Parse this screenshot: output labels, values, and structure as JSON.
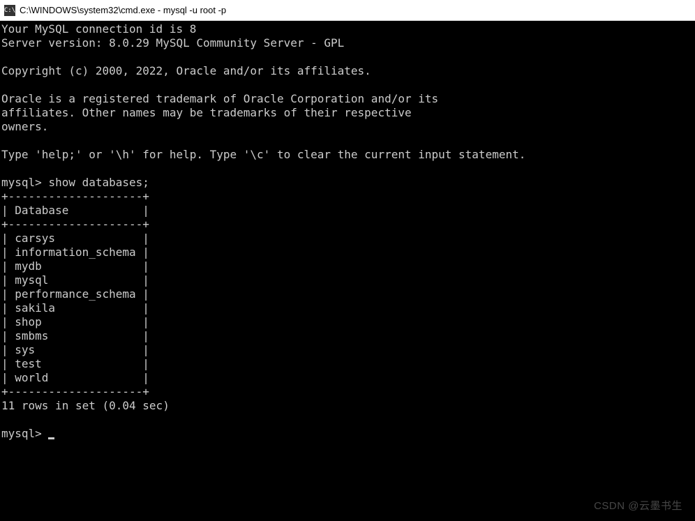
{
  "titlebar": {
    "icon_label": "C:\\",
    "title": "C:\\WINDOWS\\system32\\cmd.exe - mysql  -u root -p"
  },
  "terminal": {
    "intro": {
      "connection_id_line": "Your MySQL connection id is 8",
      "server_version_line": "Server version: 8.0.29 MySQL Community Server - GPL",
      "copyright_line": "Copyright (c) 2000, 2022, Oracle and/or its affiliates.",
      "trademark_lines": "Oracle is a registered trademark of Oracle Corporation and/or its\naffiliates. Other names may be trademarks of their respective\nowners.",
      "help_line": "Type 'help;' or '\\h' for help. Type '\\c' to clear the current input statement."
    },
    "prompt1": {
      "prompt": "mysql>",
      "command": "show databases;"
    },
    "table": {
      "border_top": "+--------------------+",
      "header_row": "| Database           |",
      "border_mid": "+--------------------+",
      "rows": [
        "| carsys             |",
        "| information_schema |",
        "| mydb               |",
        "| mysql              |",
        "| performance_schema |",
        "| sakila             |",
        "| shop               |",
        "| smbms              |",
        "| sys                |",
        "| test               |",
        "| world              |"
      ],
      "border_bottom": "+--------------------+"
    },
    "result_line": "11 rows in set (0.04 sec)",
    "prompt2": {
      "prompt": "mysql>"
    }
  },
  "watermark": "CSDN @云墨书生"
}
